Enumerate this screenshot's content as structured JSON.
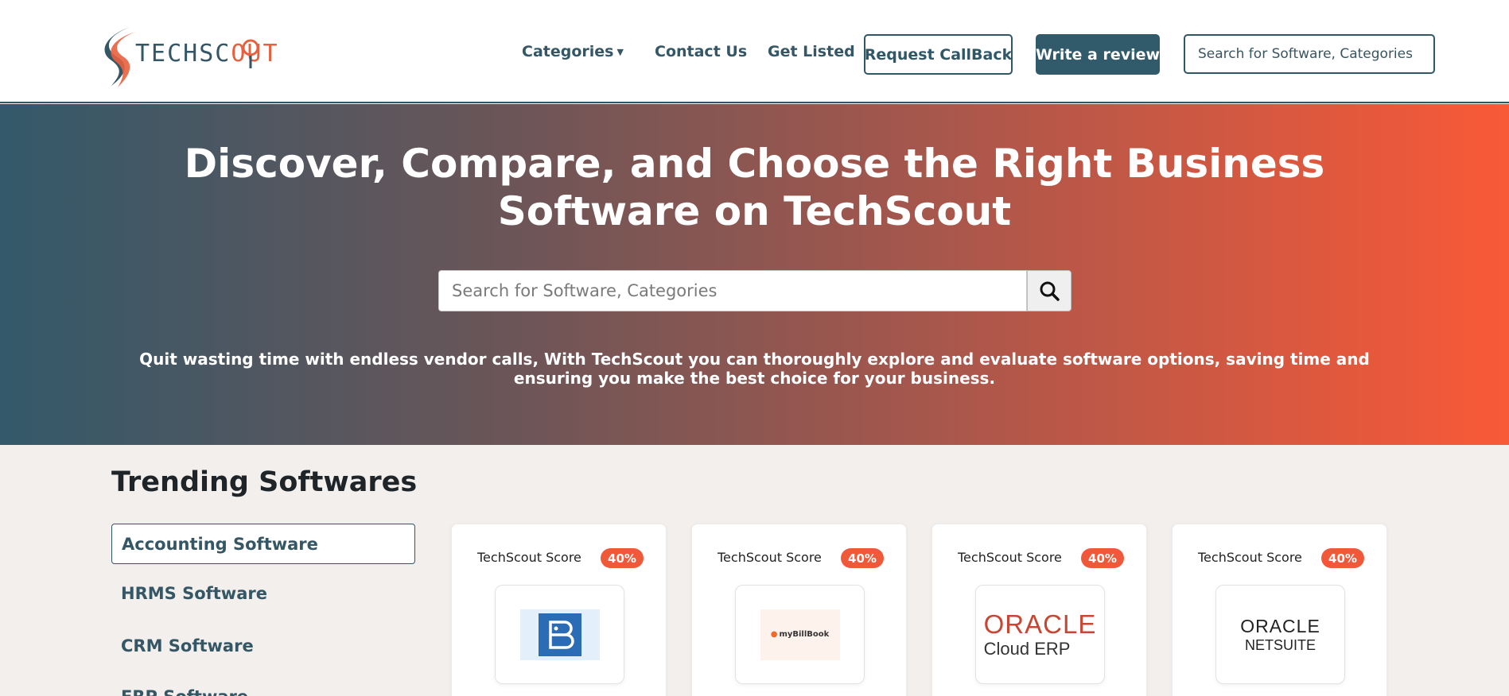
{
  "header": {
    "logo": {
      "text_tech": "TECHSC",
      "text_scout": "OUT"
    },
    "nav": {
      "categories": "Categories",
      "contact": "Contact Us",
      "get_listed": "Get Listed"
    },
    "request_callback": "Request CallBack",
    "write_review": "Write a review",
    "search_placeholder": "Search for Software, Categories"
  },
  "hero": {
    "title": "Discover, Compare, and Choose the Right Business Software on TechScout",
    "search_placeholder": "Search for Software, Categories",
    "tagline": "Quit wasting time with endless vendor calls, With TechScout you can thoroughly explore and evaluate software options, saving time and ensuring you make the best choice for your business."
  },
  "trending": {
    "title": "Trending Softwares",
    "categories": [
      {
        "label": "Accounting Software",
        "active": true
      },
      {
        "label": "HRMS Software",
        "active": false
      },
      {
        "label": "CRM Software",
        "active": false
      },
      {
        "label": "ERP Software",
        "active": false
      }
    ],
    "cards": [
      {
        "score_label": "TechScout Score",
        "score": "40%",
        "logo": "busy-logo-icon"
      },
      {
        "score_label": "TechScout Score",
        "score": "40%",
        "logo": "mybillbook-logo",
        "logo_text": "myBillBook"
      },
      {
        "score_label": "TechScout Score",
        "score": "40%",
        "logo": "oracle-cloud-erp-logo",
        "logo_line1": "ORACLE",
        "logo_line2": "Cloud ERP"
      },
      {
        "score_label": "TechScout Score",
        "score": "40%",
        "logo": "oracle-netsuite-logo",
        "logo_line1": "ORACLE",
        "logo_line2": "NETSUITE"
      }
    ]
  },
  "colors": {
    "brand_dark": "#2f5766",
    "brand_orange": "#f0583a",
    "hero_gradient_start": "#33596a",
    "hero_gradient_end": "#f95937"
  }
}
